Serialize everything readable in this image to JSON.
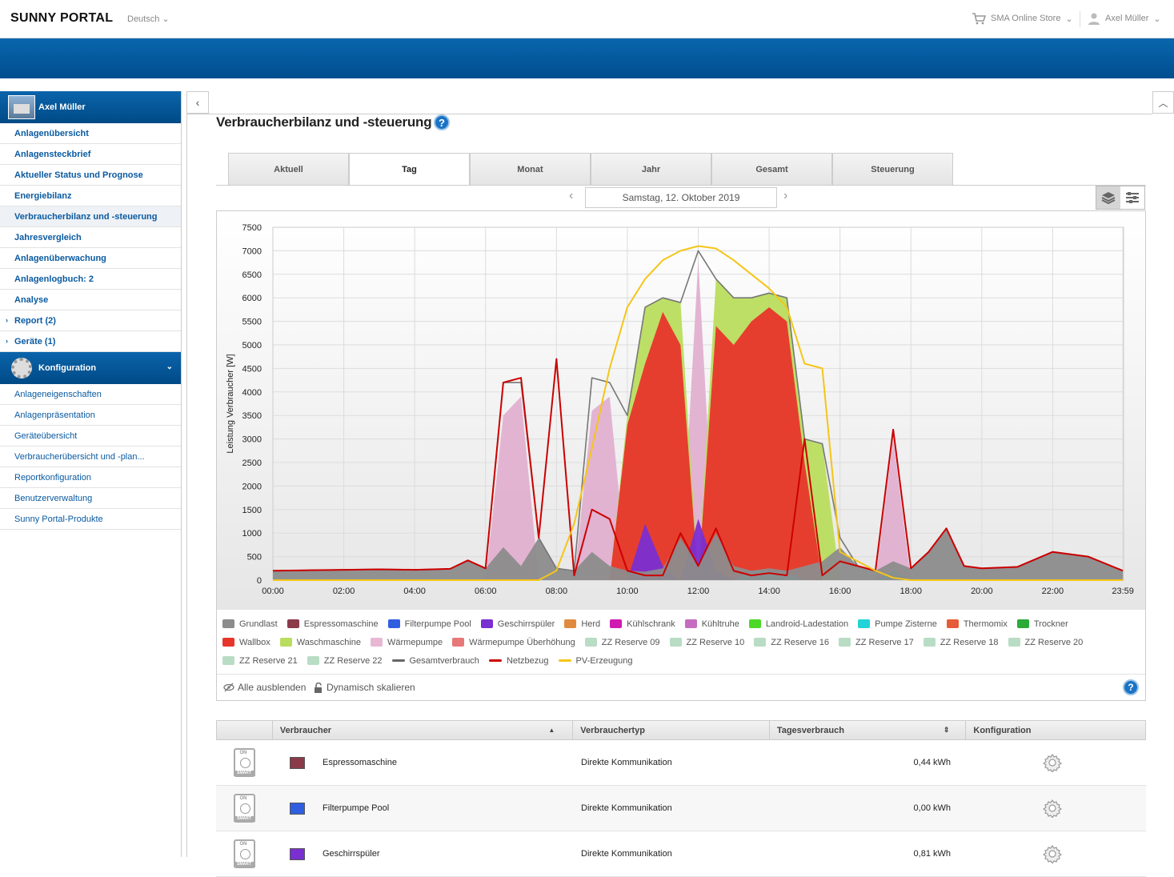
{
  "header": {
    "logo": "SUNNY PORTAL",
    "language": "Deutsch",
    "store": "SMA Online Store",
    "user": "Axel Müller"
  },
  "sidebar": {
    "plant_name": "Axel Müller",
    "items": [
      {
        "label": "Anlagenübersicht"
      },
      {
        "label": "Anlagensteckbrief"
      },
      {
        "label": "Aktueller Status und Prognose"
      },
      {
        "label": "Energiebilanz"
      },
      {
        "label": "Verbraucherbilanz und -steuerung"
      },
      {
        "label": "Jahresvergleich"
      },
      {
        "label": "Anlagenüberwachung"
      },
      {
        "label": "Anlagenlogbuch: 2"
      },
      {
        "label": "Analyse"
      },
      {
        "label": "Report (2)"
      },
      {
        "label": "Geräte (1)"
      }
    ],
    "config_title": "Konfiguration",
    "config_items": [
      {
        "label": "Anlageneigenschaften"
      },
      {
        "label": "Anlagenpräsentation"
      },
      {
        "label": "Geräteübersicht"
      },
      {
        "label": "Verbraucherübersicht und -plan..."
      },
      {
        "label": "Reportkonfiguration"
      },
      {
        "label": "Benutzerverwaltung"
      },
      {
        "label": "Sunny Portal-Produkte"
      }
    ]
  },
  "page": {
    "title": "Verbraucherbilanz und -steuerung",
    "help": "?",
    "tabs": [
      "Aktuell",
      "Tag",
      "Monat",
      "Jahr",
      "Gesamt",
      "Steuerung"
    ],
    "active_tab": "Tag",
    "date": "Samstag, 12. Oktober 2019",
    "prev": "‹",
    "next": "›"
  },
  "chart_data": {
    "type": "area",
    "ylabel": "Leistung Verbraucher [W]",
    "ylim": [
      0,
      7500
    ],
    "yticks": [
      "0",
      "500",
      "1000",
      "1500",
      "2000",
      "2500",
      "3000",
      "3500",
      "4000",
      "4500",
      "5000",
      "5500",
      "6000",
      "6500",
      "7000",
      "7500"
    ],
    "xticks": [
      "00:00",
      "02:00",
      "04:00",
      "06:00",
      "08:00",
      "10:00",
      "12:00",
      "14:00",
      "16:00",
      "18:00",
      "20:00",
      "22:00",
      "23:59"
    ],
    "x_hours": [
      0,
      1,
      2,
      3,
      4,
      5,
      5.5,
      6,
      6.5,
      7,
      7.5,
      8,
      8.5,
      9,
      9.5,
      10,
      10.5,
      11,
      11.5,
      12,
      12.5,
      13,
      13.5,
      14,
      14.5,
      15,
      15.5,
      16,
      16.5,
      17,
      17.5,
      18,
      18.5,
      19,
      19.5,
      20,
      21,
      22,
      23,
      23.98
    ],
    "series": [
      {
        "name": "Grundlast",
        "color": "#8c8c8c",
        "values": [
          200,
          210,
          220,
          230,
          220,
          240,
          420,
          250,
          700,
          300,
          900,
          250,
          200,
          600,
          300,
          200,
          180,
          250,
          900,
          300,
          1000,
          300,
          200,
          250,
          200,
          300,
          400,
          700,
          300,
          200,
          400,
          250,
          600,
          1100,
          300,
          250,
          280,
          600,
          500,
          200
        ]
      },
      {
        "name": "Wärmepumpe",
        "color": "#e0b0d0",
        "values": [
          0,
          0,
          0,
          0,
          0,
          0,
          0,
          0,
          3500,
          3900,
          0,
          0,
          0,
          3600,
          3900,
          0,
          0,
          0,
          0,
          6800,
          0,
          0,
          0,
          0,
          0,
          0,
          0,
          0,
          0,
          0,
          3000,
          0,
          0,
          0,
          0,
          0,
          0,
          0,
          0,
          0
        ]
      },
      {
        "name": "Wallbox",
        "color": "#e8352b",
        "values": [
          0,
          0,
          0,
          0,
          0,
          0,
          0,
          0,
          0,
          0,
          0,
          0,
          0,
          0,
          0,
          3300,
          4600,
          5700,
          5000,
          0,
          5400,
          5000,
          5500,
          5800,
          5500,
          2500,
          0,
          0,
          0,
          0,
          0,
          0,
          0,
          0,
          0,
          0,
          0,
          0,
          0,
          0
        ]
      },
      {
        "name": "Waschmaschine",
        "color": "#b9dd5e",
        "values": [
          0,
          0,
          0,
          0,
          0,
          0,
          0,
          0,
          0,
          0,
          0,
          0,
          0,
          0,
          0,
          0,
          0,
          0,
          0,
          0,
          0,
          800,
          300,
          300,
          300,
          300,
          100,
          0,
          0,
          0,
          0,
          0,
          0,
          0,
          0,
          0,
          0,
          0,
          0,
          0
        ]
      },
      {
        "name": "Geschirrspüler",
        "color": "#7a2fd1",
        "values": [
          0,
          0,
          0,
          0,
          0,
          0,
          0,
          0,
          0,
          0,
          0,
          0,
          0,
          0,
          0,
          0,
          1200,
          300,
          0,
          1300,
          200,
          0,
          0,
          0,
          0,
          0,
          0,
          0,
          0,
          0,
          0,
          0,
          0,
          0,
          0,
          0,
          0,
          0,
          0,
          0
        ]
      },
      {
        "name": "Pumpe Zisterne",
        "color": "#22d3d8",
        "values": [
          0,
          0,
          0,
          0,
          0,
          0,
          0,
          0,
          0,
          0,
          0,
          0,
          0,
          0,
          0,
          0,
          0,
          0,
          0,
          0,
          0,
          0,
          200,
          200,
          150,
          0,
          0,
          0,
          0,
          0,
          200,
          0,
          0,
          0,
          0,
          0,
          0,
          0,
          0,
          0
        ]
      },
      {
        "name": "Gesamtverbrauch",
        "color": "#777777",
        "values": [
          200,
          210,
          220,
          230,
          220,
          240,
          420,
          250,
          4200,
          4200,
          900,
          250,
          200,
          4300,
          4200,
          3500,
          5800,
          6000,
          5900,
          7000,
          6400,
          6000,
          6000,
          6100,
          6000,
          3000,
          2900,
          900,
          300,
          200,
          3200,
          250,
          600,
          1100,
          300,
          250,
          280,
          600,
          500,
          200
        ]
      },
      {
        "name": "Netzbezug",
        "color": "#cc0000",
        "values": [
          200,
          210,
          220,
          230,
          220,
          240,
          420,
          250,
          4200,
          4300,
          900,
          4700,
          100,
          1500,
          1300,
          200,
          100,
          100,
          1000,
          300,
          1100,
          200,
          100,
          150,
          100,
          3000,
          100,
          400,
          300,
          200,
          3200,
          250,
          600,
          1100,
          300,
          250,
          280,
          600,
          500,
          200
        ]
      },
      {
        "name": "PV-Erzeugung",
        "color": "#f5c518",
        "values": [
          0,
          0,
          0,
          0,
          0,
          0,
          0,
          0,
          0,
          0,
          0,
          200,
          1200,
          2800,
          4500,
          5800,
          6400,
          6800,
          7000,
          7100,
          7050,
          6800,
          6500,
          6200,
          5800,
          4600,
          4500,
          600,
          400,
          200,
          50,
          0,
          0,
          0,
          0,
          0,
          0,
          0,
          0,
          0
        ]
      }
    ]
  },
  "legend": {
    "row1": [
      {
        "label": "Grundlast",
        "color": "#8c8c8c"
      },
      {
        "label": "Espressomaschine",
        "color": "#8b3a4a"
      },
      {
        "label": "Filterpumpe Pool",
        "color": "#2f5fe0"
      },
      {
        "label": "Geschirrspüler",
        "color": "#7a2fd1"
      },
      {
        "label": "Herd",
        "color": "#e08a40"
      },
      {
        "label": "Kühlschrank",
        "color": "#d01bb0"
      },
      {
        "label": "Kühltruhe",
        "color": "#c56cc0"
      },
      {
        "label": "Landroid-Ladestation",
        "color": "#4cd829"
      },
      {
        "label": "Pumpe Zisterne",
        "color": "#22d3d8"
      },
      {
        "label": "Thermomix",
        "color": "#e65c38"
      },
      {
        "label": "Trockner",
        "color": "#2aaa38"
      }
    ],
    "row2": [
      {
        "label": "Wallbox",
        "color": "#e8352b"
      },
      {
        "label": "Waschmaschine",
        "color": "#b9dd5e"
      },
      {
        "label": "Wärmepumpe",
        "color": "#e8b7d4"
      },
      {
        "label": "Wärmepumpe Überhöhung",
        "color": "#e77878"
      },
      {
        "label": "ZZ Reserve 09",
        "color": "#b9dcc4"
      },
      {
        "label": "ZZ Reserve 10",
        "color": "#b9dcc4"
      },
      {
        "label": "ZZ Reserve 16",
        "color": "#b9dcc4"
      },
      {
        "label": "ZZ Reserve 17",
        "color": "#b9dcc4"
      },
      {
        "label": "ZZ Reserve 18",
        "color": "#b9dcc4"
      },
      {
        "label": "ZZ Reserve 20",
        "color": "#b9dcc4"
      }
    ],
    "row3": [
      {
        "label": "ZZ Reserve 21",
        "color": "#b9dcc4",
        "kind": "box"
      },
      {
        "label": "ZZ Reserve 22",
        "color": "#b9dcc4",
        "kind": "box"
      },
      {
        "label": "Gesamtverbrauch",
        "color": "#666666",
        "kind": "line"
      },
      {
        "label": "Netzbezug",
        "color": "#cc0000",
        "kind": "line"
      },
      {
        "label": "PV-Erzeugung",
        "color": "#f5c518",
        "kind": "line"
      }
    ],
    "hide_all": "Alle ausblenden",
    "dyn_scale": "Dynamisch skalieren"
  },
  "table": {
    "headers": [
      "Verbraucher",
      "Verbrauchertyp",
      "Tagesverbrauch",
      "Konfiguration"
    ],
    "rows": [
      {
        "name": "Espressomaschine",
        "color": "#8b3a4a",
        "type": "Direkte Kommunikation",
        "energy": "0,44 kWh"
      },
      {
        "name": "Filterpumpe Pool",
        "color": "#2f5fe0",
        "type": "Direkte Kommunikation",
        "energy": "0,00 kWh"
      },
      {
        "name": "Geschirrspüler",
        "color": "#7a2fd1",
        "type": "Direkte Kommunikation",
        "energy": "0,81 kWh"
      }
    ],
    "smart_label": "SMART"
  }
}
